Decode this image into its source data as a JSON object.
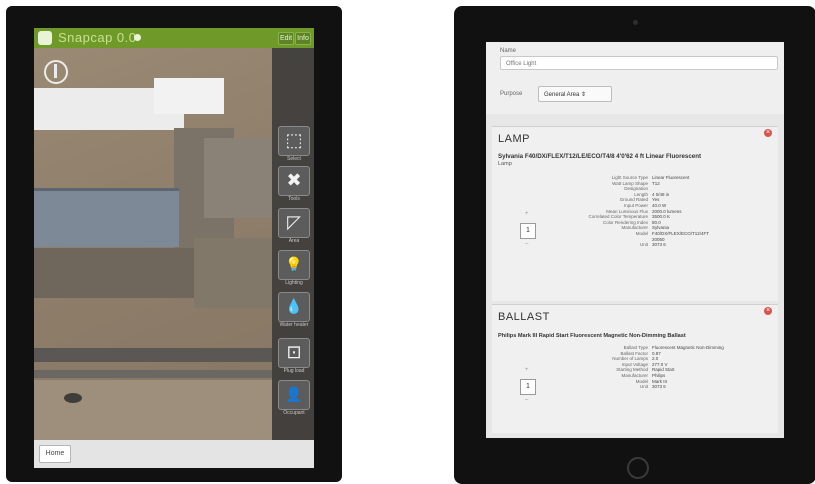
{
  "left_tablet": {
    "app_title": "Snapcap  0.0",
    "topbar_buttons": [
      "Edit",
      "Info"
    ],
    "tools": [
      {
        "icon": "select-area-icon",
        "glyph": "⬚",
        "caption": "Select"
      },
      {
        "icon": "tools-icon",
        "glyph": "✖",
        "caption": "Tools"
      },
      {
        "icon": "area-icon",
        "glyph": "◸",
        "caption": "Area"
      },
      {
        "icon": "lighting-icon",
        "glyph": "💡",
        "caption": "Lighting"
      },
      {
        "icon": "water-icon",
        "glyph": "💧",
        "caption": "Water heater"
      },
      {
        "icon": "outlet-icon",
        "glyph": "⊡",
        "caption": "Plug load"
      },
      {
        "icon": "person-icon",
        "glyph": "👤",
        "caption": "Occupant"
      }
    ],
    "home_label": "Home"
  },
  "right_tablet": {
    "form": {
      "name_label": "Name",
      "name_value": "Office Light",
      "purpose_label": "Purpose",
      "purpose_value": "General Area  ⇕"
    },
    "lamp": {
      "title": "LAMP",
      "product": "Sylvania F40/DX/FLEX/T12/LE/ECO/T4/8 4'0'62 4 ft Linear Fluorescent",
      "subtype": "Lamp",
      "quantity": "1",
      "specs": [
        {
          "k": "Light Source Type",
          "v": "Linear Fluorescent"
        },
        {
          "k": "Watt Lamp Shape",
          "v": "T12"
        },
        {
          "k": "Designation",
          "v": ""
        },
        {
          "k": "Length",
          "v": "4 0/48 in"
        },
        {
          "k": "Ground Rated",
          "v": "Yes"
        },
        {
          "k": "Input Power",
          "v": "40.0 W"
        },
        {
          "k": "Mean Luminous Flux",
          "v": "2000.0 lumens"
        },
        {
          "k": "Correlated Color Temperature",
          "v": "3500.0 K"
        },
        {
          "k": "Color Rendering Index",
          "v": "80.0"
        },
        {
          "k": "Manufacturer",
          "v": "Sylvania"
        },
        {
          "k": "Model",
          "v": "F40/DX/FLEX/ECO/T12/4FT"
        },
        {
          "k": "",
          "v": "20050"
        },
        {
          "k": "Unit",
          "v": "3073 6"
        }
      ]
    },
    "ballast": {
      "title": "BALLAST",
      "product": "Philips Mark III Rapid Start Fluorescent Magnetic Non-Dimming Ballast",
      "quantity": "1",
      "specs": [
        {
          "k": "Ballast Type",
          "v": "Fluorescent Magnetic Non-Dimming"
        },
        {
          "k": "Ballast Factor",
          "v": "0.87"
        },
        {
          "k": "Number of Lamps",
          "v": "2.0"
        },
        {
          "k": "Input Voltage",
          "v": "277.0 V"
        },
        {
          "k": "Starting Method",
          "v": "Rapid Start"
        },
        {
          "k": "Manufacturer",
          "v": "Philips"
        },
        {
          "k": "Model",
          "v": "Mark III"
        },
        {
          "k": "Unit",
          "v": "3073 6"
        }
      ]
    }
  }
}
